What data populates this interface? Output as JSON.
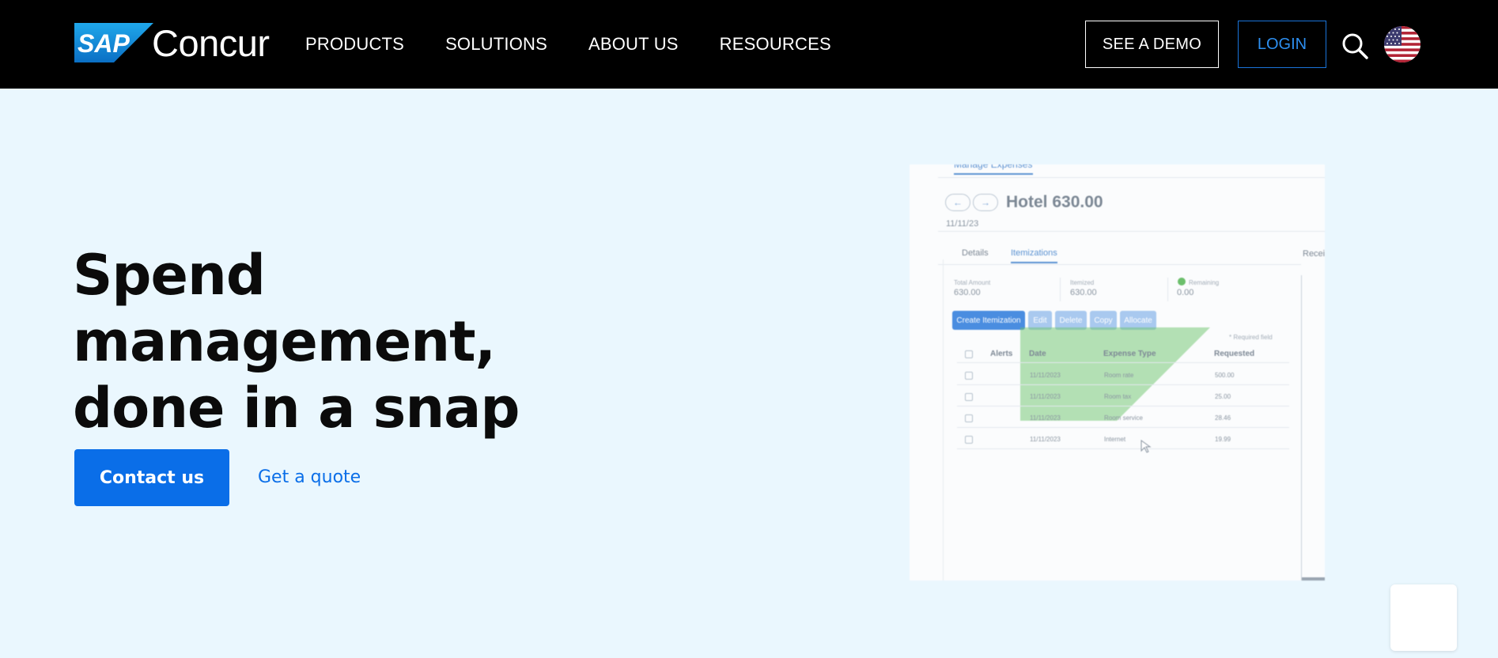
{
  "header": {
    "logo_brand": "SAP",
    "logo_product": "Concur",
    "nav": [
      "PRODUCTS",
      "SOLUTIONS",
      "ABOUT US",
      "RESOURCES"
    ],
    "demo_label": "SEE A DEMO",
    "login_label": "LOGIN",
    "search_icon": "search-icon",
    "locale_icon": "us-flag-icon"
  },
  "hero": {
    "title_line1": "Spend management,",
    "title_line2": "done in a snap",
    "primary_cta": "Contact us",
    "secondary_cta": "Get a quote"
  },
  "product_screenshot": {
    "tab": "Manage Expenses",
    "title": "Hotel 630.00",
    "date": "11/11/23",
    "subtabs": [
      "Details",
      "Itemizations"
    ],
    "active_subtab": "Itemizations",
    "side_tab": "Recei",
    "summary": [
      {
        "label": "Total Amount",
        "value": "630.00"
      },
      {
        "label": "Itemized",
        "value": "630.00"
      },
      {
        "label": "Remaining",
        "value": "0.00"
      }
    ],
    "actions": [
      "Create Itemization",
      "Edit",
      "Delete",
      "Copy",
      "Allocate"
    ],
    "required_note": "* Required field",
    "columns": [
      "Alerts",
      "Date",
      "Expense Type",
      "Requested"
    ],
    "rows": [
      {
        "date": "11/11/2023",
        "type": "Room rate",
        "amount": "500.00"
      },
      {
        "date": "11/11/2023",
        "type": "Room tax",
        "amount": "25.00"
      },
      {
        "date": "11/11/2023",
        "type": "Room service",
        "amount": "28.46"
      },
      {
        "date": "11/11/2023",
        "type": "Internet",
        "amount": "19.99"
      }
    ]
  },
  "colors": {
    "nav_bg": "#000000",
    "page_bg": "#eaf7fe",
    "primary": "#0a6ee8",
    "login_blue": "#2d8ff0"
  }
}
